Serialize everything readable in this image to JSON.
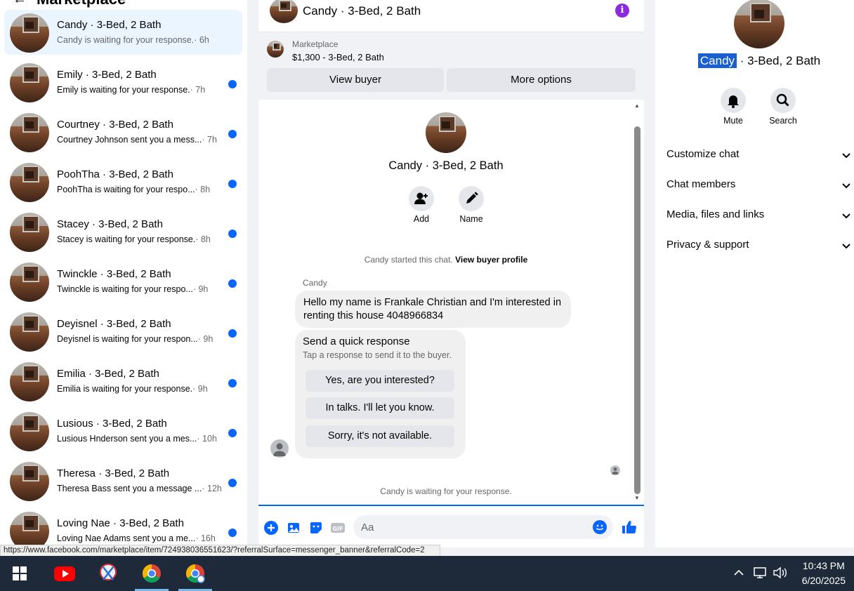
{
  "left": {
    "title": "Marketplace",
    "conversations": [
      {
        "name": "Candy · 3-Bed, 2 Bath",
        "snippet": "Candy is waiting for your response.",
        "time": " · 6h",
        "active": true,
        "unread": false
      },
      {
        "name": "Emily · 3-Bed, 2 Bath",
        "snippet": "Emily is waiting for your response.",
        "time": " · 7h",
        "unread": true
      },
      {
        "name": "Courtney · 3-Bed, 2 Bath",
        "snippet": "Courtney Johnson sent you a mess...",
        "time": " · 7h",
        "unread": true
      },
      {
        "name": "PoohTha · 3-Bed, 2 Bath",
        "snippet": "PoohTha is waiting for your respo...",
        "time": " · 8h",
        "unread": true
      },
      {
        "name": "Stacey · 3-Bed, 2 Bath",
        "snippet": "Stacey is waiting for your response.",
        "time": " · 8h",
        "unread": true
      },
      {
        "name": "Twinckle · 3-Bed, 2 Bath",
        "snippet": "Twinckle is waiting for your respo...",
        "time": " · 9h",
        "unread": true
      },
      {
        "name": "Deyisnel · 3-Bed, 2 Bath",
        "snippet": "Deyisnel is waiting for your respon...",
        "time": " · 9h",
        "unread": true
      },
      {
        "name": "Emilia · 3-Bed, 2 Bath",
        "snippet": "Emilia is waiting for your response.",
        "time": " · 9h",
        "unread": true
      },
      {
        "name": "Lusious · 3-Bed, 2 Bath",
        "snippet": "Lusious Hnderson sent you a mes...",
        "time": " · 10h",
        "unread": true
      },
      {
        "name": "Theresa · 3-Bed, 2 Bath",
        "snippet": "Theresa Bass sent you a message ...",
        "time": " · 12h",
        "unread": true
      },
      {
        "name": "Loving Nae · 3-Bed, 2 Bath",
        "snippet": "Loving Nae Adams sent you a me...",
        "time": " · 16h",
        "unread": true
      }
    ]
  },
  "chat": {
    "header_title": "Candy · 3-Bed, 2 Bath",
    "banner": {
      "label": "Marketplace",
      "price_line": "$1,300 - 3-Bed, 2 Bath",
      "view_buyer": "View buyer",
      "more_options": "More options"
    },
    "profile_name": "Candy · 3-Bed, 2 Bath",
    "add_label": "Add",
    "name_label": "Name",
    "started_text": "Candy started this chat.",
    "view_profile": "View buyer profile",
    "sender": "Candy",
    "message": "Hello my name is Frankale Christian and I'm interested in renting this house 4048966834",
    "quick": {
      "title": "Send a quick response",
      "subtitle": "Tap a response to send it to the buyer.",
      "options": [
        "Yes, are you interested?",
        "In talks. I'll let you know.",
        "Sorry, it's not available."
      ]
    },
    "waiting_text": "Candy is waiting for your response.",
    "composer_placeholder": "Aa"
  },
  "right": {
    "name_selected": "Candy",
    "name_rest": " · 3-Bed, 2 Bath",
    "mute_label": "Mute",
    "search_label": "Search",
    "sections": [
      "Customize chat",
      "Chat members",
      "Media, files and links",
      "Privacy & support"
    ]
  },
  "status_url": "https://www.facebook.com/marketplace/item/724938036551623/?referralSurface=messenger_banner&referralCode=2",
  "taskbar": {
    "time": "10:43 PM",
    "date": "6/20/2025"
  },
  "colors": {
    "accent": "#0866ff",
    "info": "#8a2be2",
    "taskbar": "#1e2a3a"
  }
}
